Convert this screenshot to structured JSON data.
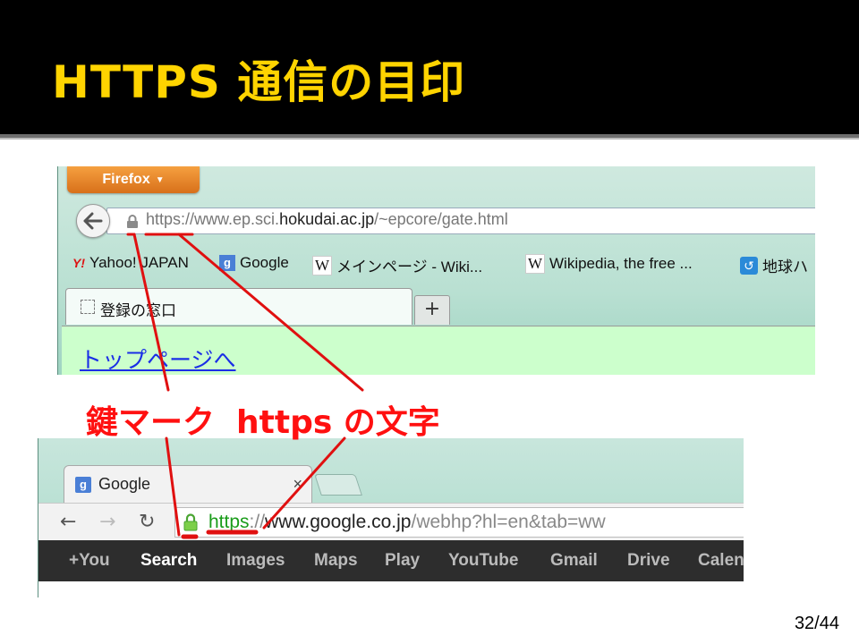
{
  "slide": {
    "title": "HTTPS 通信の目印",
    "page_number": "32/44"
  },
  "firefox": {
    "menu_button": "Firefox",
    "url_prefix": "https://www.ep.sci.",
    "url_domain": "hokudai.ac.jp",
    "url_path": "/~epcore/gate.html",
    "bookmarks": [
      {
        "icon": "yahoo-icon",
        "label": "Yahoo! JAPAN"
      },
      {
        "icon": "google-icon",
        "label": "Google"
      },
      {
        "icon": "wikipedia-icon",
        "label": "メインページ - Wiki..."
      },
      {
        "icon": "wikipedia-icon",
        "label": "Wikipedia, the free ..."
      },
      {
        "icon": "earth-icon",
        "label": "地球ハ"
      }
    ],
    "tab_title": "登録の窓口",
    "new_tab": "+",
    "page_link": "トップページへ"
  },
  "chrome": {
    "tab_title": "Google",
    "tab_close": "×",
    "url_https": "https",
    "url_sep": "://",
    "url_domain": "www.google.co.jp",
    "url_path": "/webhp?hl=en&tab=ww",
    "google_bar": [
      {
        "label": "+You",
        "active": false
      },
      {
        "label": "Search",
        "active": true
      },
      {
        "label": "Images",
        "active": false
      },
      {
        "label": "Maps",
        "active": false
      },
      {
        "label": "Play",
        "active": false
      },
      {
        "label": "YouTube",
        "active": false
      },
      {
        "label": "Gmail",
        "active": false
      },
      {
        "label": "Drive",
        "active": false
      },
      {
        "label": "Calen",
        "active": false
      }
    ]
  },
  "annotation": {
    "lock_label": "鍵マーク",
    "https_label": "https の文字",
    "color": "#ff1010"
  }
}
